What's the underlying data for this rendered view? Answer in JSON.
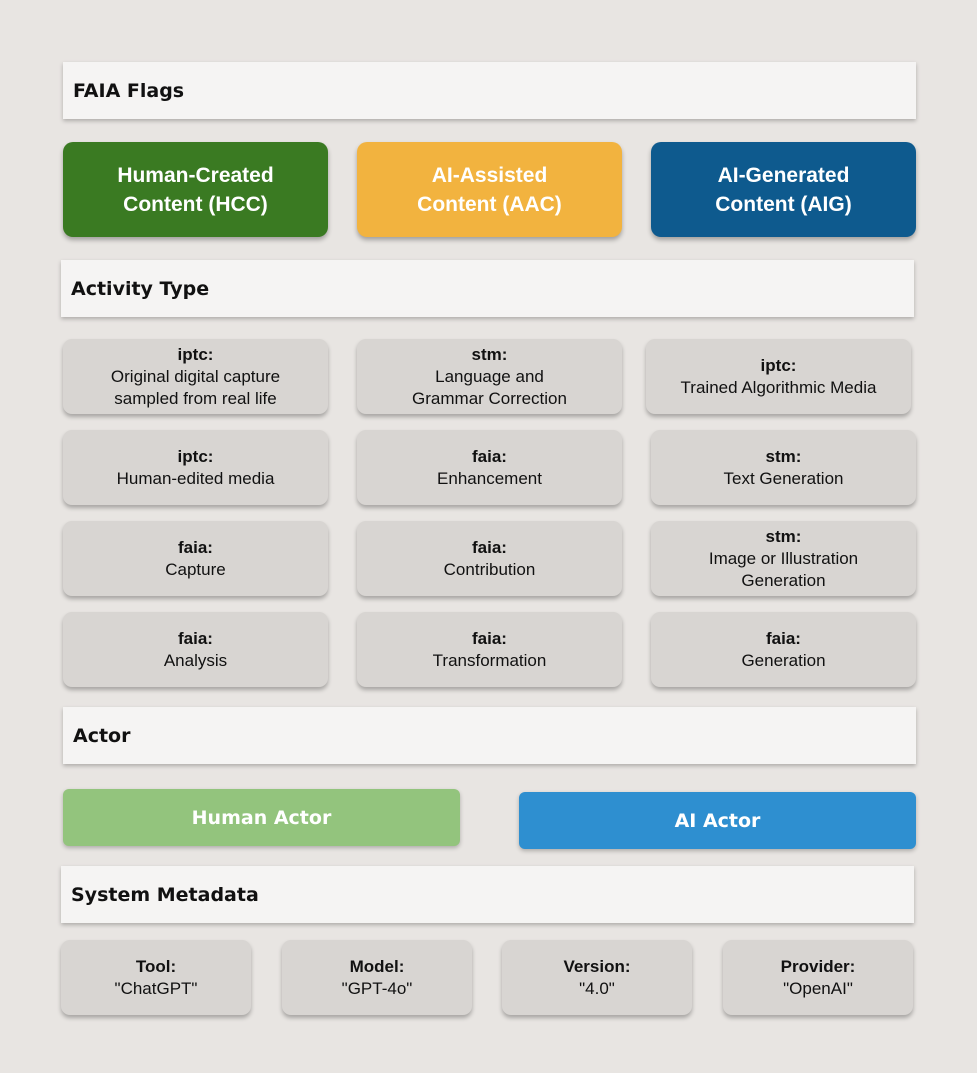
{
  "sections": {
    "faia_flags": "FAIA Flags",
    "activity_type": "Activity Type",
    "actor": "Actor",
    "system_metadata": "System Metadata"
  },
  "flags": [
    {
      "line1": "Human-Created",
      "line2": "Content (HCC)",
      "color": "#3a7a22"
    },
    {
      "line1": "AI-Assisted",
      "line2": "Content (AAC)",
      "color": "#f2b33f"
    },
    {
      "line1": "AI-Generated",
      "line2": "Content (AIG)",
      "color": "#0e5a8e"
    }
  ],
  "activities": [
    [
      {
        "prefix": "iptc:",
        "text": "Original digital capture\nsampled from real life"
      },
      {
        "prefix": "stm:",
        "text": "Language and\nGrammar Correction"
      },
      {
        "prefix": "iptc:",
        "text": "Trained Algorithmic Media"
      }
    ],
    [
      {
        "prefix": "iptc:",
        "text": "Human-edited media"
      },
      {
        "prefix": "faia:",
        "text": "Enhancement"
      },
      {
        "prefix": "stm:",
        "text": "Text Generation"
      }
    ],
    [
      {
        "prefix": "faia:",
        "text": "Capture"
      },
      {
        "prefix": "faia:",
        "text": "Contribution"
      },
      {
        "prefix": "stm:",
        "text": "Image or Illustration\nGeneration"
      }
    ],
    [
      {
        "prefix": "faia:",
        "text": "Analysis"
      },
      {
        "prefix": "faia:",
        "text": "Transformation"
      },
      {
        "prefix": "faia:",
        "text": "Generation"
      }
    ]
  ],
  "actors": [
    {
      "label": "Human Actor",
      "color": "#93c47d"
    },
    {
      "label": "AI Actor",
      "color": "#2e8fd0"
    }
  ],
  "metadata": [
    {
      "key": "Tool:",
      "value": "\"ChatGPT\""
    },
    {
      "key": "Model:",
      "value": "\"GPT-4o\""
    },
    {
      "key": "Version:",
      "value": "\"4.0\""
    },
    {
      "key": "Provider:",
      "value": "\"OpenAI\""
    }
  ]
}
